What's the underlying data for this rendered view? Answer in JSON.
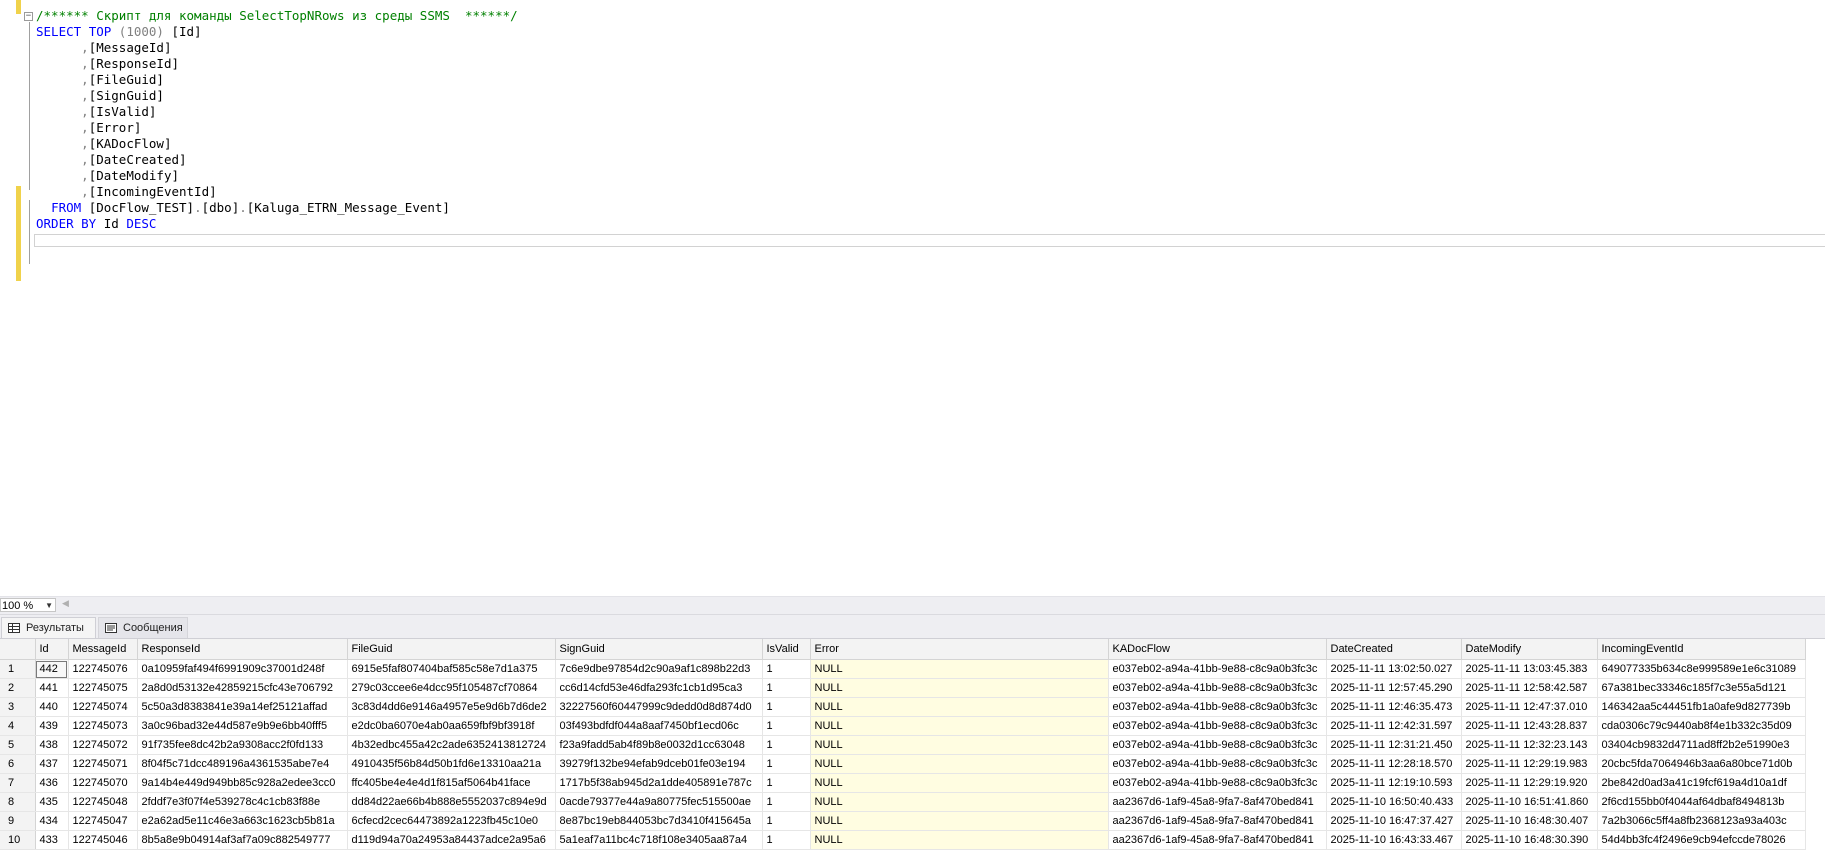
{
  "editor": {
    "comment": "/****** Скрипт для команды SelectTopNRows из среды SSMS  ******/",
    "select_kw": "SELECT",
    "top_kw": "TOP",
    "top_value": "(1000)",
    "first_column": "[Id]",
    "columns": [
      "[MessageId]",
      "[ResponseId]",
      "[FileGuid]",
      "[SignGuid]",
      "[IsValid]",
      "[Error]",
      "[KADocFlow]",
      "[DateCreated]",
      "[DateModify]",
      "[IncomingEventId]"
    ],
    "from_kw": "FROM",
    "from_db": "[DocFlow_TEST]",
    "from_schema": "[dbo]",
    "from_table": "[Kaluga_ETRN_Message_Event]",
    "order_kw": "ORDER BY",
    "order_col": "Id",
    "desc_kw": "DESC"
  },
  "zoom": {
    "value": "100 %"
  },
  "tabs": [
    {
      "label": "Результаты",
      "icon": "grid-icon"
    },
    {
      "label": "Сообщения",
      "icon": "messages-icon"
    }
  ],
  "grid": {
    "columns": [
      "",
      "Id",
      "MessageId",
      "ResponseId",
      "FileGuid",
      "SignGuid",
      "IsValid",
      "Error",
      "KADocFlow",
      "DateCreated",
      "DateModify",
      "IncomingEventId"
    ],
    "rows": [
      [
        "1",
        "442",
        "122745076",
        "0a10959faf494f6991909c37001d248f",
        "6915e5faf807404baf585c58e7d1a375",
        "7c6e9dbe97854d2c90a9af1c898b22d3",
        "1",
        "NULL",
        "e037eb02-a94a-41bb-9e88-c8c9a0b3fc3c",
        "2025-11-11 13:02:50.027",
        "2025-11-11 13:03:45.383",
        "649077335b634c8e999589e1e6c31089"
      ],
      [
        "2",
        "441",
        "122745075",
        "2a8d0d53132e42859215cfc43e706792",
        "279c03ccee6e4dcc95f105487cf70864",
        "cc6d14cfd53e46dfa293fc1cb1d95ca3",
        "1",
        "NULL",
        "e037eb02-a94a-41bb-9e88-c8c9a0b3fc3c",
        "2025-11-11 12:57:45.290",
        "2025-11-11 12:58:42.587",
        "67a381bec33346c185f7c3e55a5d121"
      ],
      [
        "3",
        "440",
        "122745074",
        "5c50a3d8383841e39a14ef25121affad",
        "3c83d4dd6e9146a4957e5e9d6b7d6de2",
        "32227560f60447999c9dedd0d8d874d0",
        "1",
        "NULL",
        "e037eb02-a94a-41bb-9e88-c8c9a0b3fc3c",
        "2025-11-11 12:46:35.473",
        "2025-11-11 12:47:37.010",
        "146342aa5c44451fb1a0afe9d827739b"
      ],
      [
        "4",
        "439",
        "122745073",
        "3a0c96bad32e44d587e9b9e6bb40fff5",
        "e2dc0ba6070e4ab0aa659fbf9bf3918f",
        "03f493bdfdf044a8aaf7450bf1ecd06c",
        "1",
        "NULL",
        "e037eb02-a94a-41bb-9e88-c8c9a0b3fc3c",
        "2025-11-11 12:42:31.597",
        "2025-11-11 12:43:28.837",
        "cda0306c79c9440ab8f4e1b332c35d09"
      ],
      [
        "5",
        "438",
        "122745072",
        "91f735fee8dc42b2a9308acc2f0fd133",
        "4b32edbc455a42c2ade6352413812724",
        "f23a9fadd5ab4f89b8e0032d1cc63048",
        "1",
        "NULL",
        "e037eb02-a94a-41bb-9e88-c8c9a0b3fc3c",
        "2025-11-11 12:31:21.450",
        "2025-11-11 12:32:23.143",
        "03404cb9832d4711ad8ff2b2e51990e3"
      ],
      [
        "6",
        "437",
        "122745071",
        "8f04f5c71dcc489196a4361535abe7e4",
        "4910435f56b84d50b1fd6e13310aa21a",
        "39279f132be94efab9dceb01fe03e194",
        "1",
        "NULL",
        "e037eb02-a94a-41bb-9e88-c8c9a0b3fc3c",
        "2025-11-11 12:28:18.570",
        "2025-11-11 12:29:19.983",
        "20cbc5fda7064946b3aa6a80bce71d0b"
      ],
      [
        "7",
        "436",
        "122745070",
        "9a14b4e449d949bb85c928a2edee3cc0",
        "ffc405be4e4e4d1f815af5064b41face",
        "1717b5f38ab945d2a1dde405891e787c",
        "1",
        "NULL",
        "e037eb02-a94a-41bb-9e88-c8c9a0b3fc3c",
        "2025-11-11 12:19:10.593",
        "2025-11-11 12:29:19.920",
        "2be842d0ad3a41c19fcf619a4d10a1df"
      ],
      [
        "8",
        "435",
        "122745048",
        "2fddf7e3f07f4e539278c4c1cb83f88e",
        "dd84d22ae66b4b888e5552037c894e9d",
        "0acde79377e44a9a80775fec515500ae",
        "1",
        "NULL",
        "aa2367d6-1af9-45a8-9fa7-8af470bed841",
        "2025-11-10 16:50:40.433",
        "2025-11-10 16:51:41.860",
        "2f6cd155bb0f4044af64dbaf8494813b"
      ],
      [
        "9",
        "434",
        "122745047",
        "e2a62ad5e11c46e3a663c1623cb5b81a",
        "6cfecd2cec64473892a1223fb45c10e0",
        "8e87bc19eb844053bc7d3410f415645a",
        "1",
        "NULL",
        "aa2367d6-1af9-45a8-9fa7-8af470bed841",
        "2025-11-10 16:47:37.427",
        "2025-11-10 16:48:30.407",
        "7a2b3066c5ff4a8fb2368123a93a403c"
      ],
      [
        "10",
        "433",
        "122745046",
        "8b5a8e9b04914af3af7a09c882549777",
        "d119d94a70a24953a84437adce2a95a6",
        "5a1eaf7a11bc4c718f108e3405aa87a4",
        "1",
        "NULL",
        "aa2367d6-1af9-45a8-9fa7-8af470bed841",
        "2025-11-10 16:43:33.467",
        "2025-11-10 16:48:30.390",
        "54d4bb3fc4f2496e9cb94efccde78026"
      ]
    ]
  },
  "colors": {
    "keyword": "#0000ff",
    "comment": "#008000",
    "null_cell": "#fffde1",
    "change_marker": "#f0d24b"
  }
}
